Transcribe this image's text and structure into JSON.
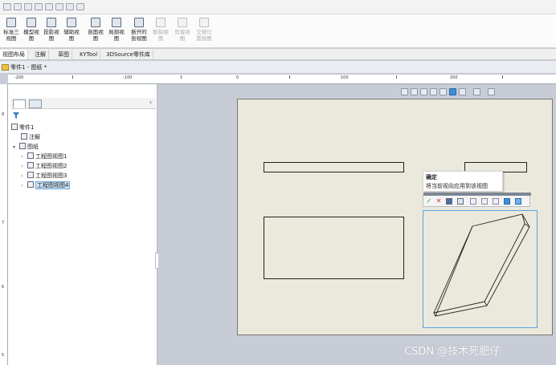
{
  "ribbon": {
    "buttons": [
      {
        "label": "标准三\n视图",
        "enabled": true
      },
      {
        "label": "模型视\n图",
        "enabled": true
      },
      {
        "label": "投影视\n图",
        "enabled": true
      },
      {
        "label": "辅助视\n图",
        "enabled": true
      },
      {
        "label": "剖面视\n图",
        "enabled": true
      },
      {
        "label": "局部视\n图",
        "enabled": true
      },
      {
        "label": "断开的\n剖视图",
        "enabled": true
      },
      {
        "label": "断裂视\n图",
        "enabled": false
      },
      {
        "label": "剪裁视\n图",
        "enabled": false
      },
      {
        "label": "交替位\n置视图",
        "enabled": false
      }
    ]
  },
  "tabs": [
    {
      "label": "视图布局",
      "active": true
    },
    {
      "label": "注解",
      "active": false
    },
    {
      "label": "草图",
      "active": false
    },
    {
      "label": "KYTool",
      "active": false
    },
    {
      "label": "3DSource零件库",
      "active": false
    }
  ],
  "document": {
    "title": "零件1 - 图纸 *"
  },
  "ruler": {
    "h_labels": [
      "-200",
      "-100",
      "0",
      "100",
      "200"
    ],
    "v_labels": [
      "8",
      "7",
      "6",
      "5"
    ]
  },
  "tree": {
    "root": "零件1",
    "annotations": "注解",
    "sheet": "图纸",
    "views": [
      "工程图视图1",
      "工程图视图2",
      "工程图视图3",
      "工程图视图4"
    ],
    "selected_view_index": 3
  },
  "tooltip": {
    "title": "确定",
    "description": "将当前视向应用到该视图"
  },
  "popup_toolbar": {
    "ok_icon": "✓",
    "cancel_icon": "✕"
  },
  "watermark": "CSDN @技术死肥仔",
  "colors": {
    "selection_blue": "#5aa0e6",
    "sheet": "#ebe9dc",
    "background": "#c7ccd6"
  }
}
